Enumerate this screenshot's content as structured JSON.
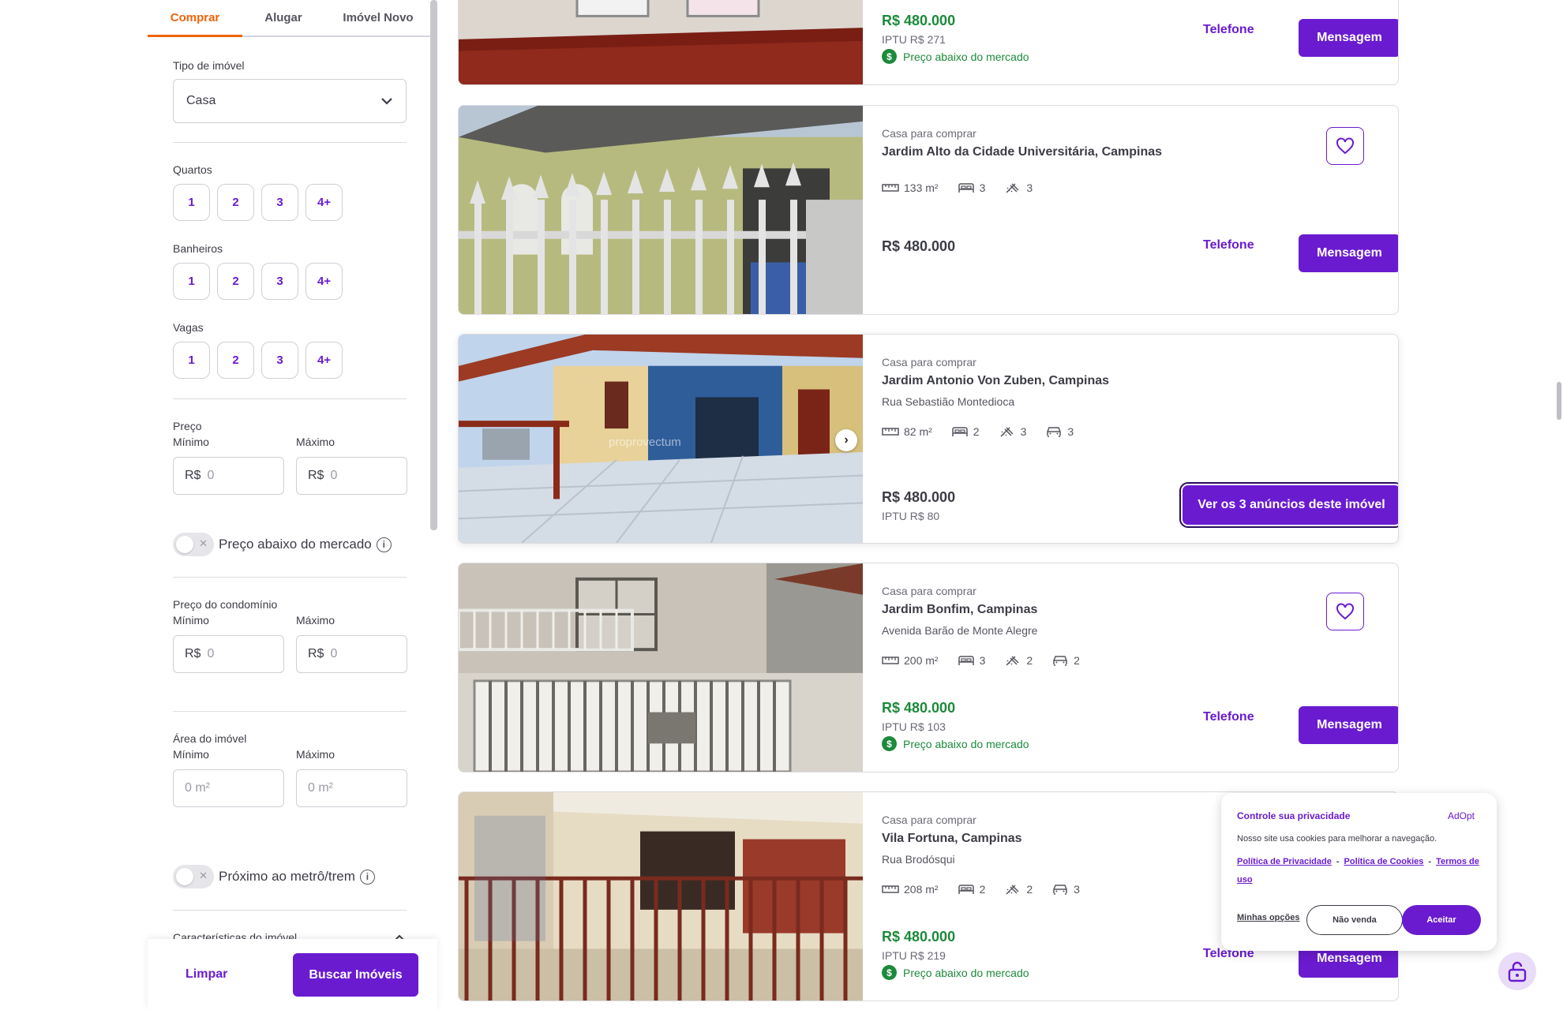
{
  "sidebar": {
    "tabs": [
      "Comprar",
      "Alugar",
      "Imóvel Novo"
    ],
    "property_type_label": "Tipo de imóvel",
    "property_type_value": "Casa",
    "bedrooms_label": "Quartos",
    "bathrooms_label": "Banheiros",
    "parking_label": "Vagas",
    "chip_options": [
      "1",
      "2",
      "3",
      "4+"
    ],
    "price_label": "Preço",
    "min_label": "Mínimo",
    "max_label": "Máximo",
    "currency_prefix": "R$",
    "money_placeholder": "0",
    "below_market_label": "Preço abaixo do mercado",
    "condo_price_label": "Preço do condomínio",
    "area_label": "Área do imóvel",
    "area_placeholder": "0 m²",
    "near_metro_label": "Próximo ao metrô/trem",
    "features_label": "Características do imóvel",
    "clear_label": "Limpar",
    "search_label": "Buscar Imóveis",
    "toggle_off_glyph": "✕",
    "info_glyph": "i"
  },
  "listings": [
    {
      "price": "R$ 480.000",
      "iptu": "IPTU R$ 271",
      "below_market": "Preço abaixo do mercado",
      "phone_label": "Telefone",
      "message_label": "Mensagem"
    },
    {
      "kind": "Casa para comprar",
      "place": "Jardim Alto da Cidade Universitária, Campinas",
      "area": "133 m²",
      "beds": "3",
      "baths": "3",
      "price": "R$ 480.000",
      "phone_label": "Telefone",
      "message_label": "Mensagem"
    },
    {
      "kind": "Casa para comprar",
      "place": "Jardim Antonio Von Zuben, Campinas",
      "street": "Rua Sebastião Montedioca",
      "area": "82 m²",
      "beds": "2",
      "baths": "3",
      "parking": "3",
      "price": "R$ 480.000",
      "iptu": "IPTU R$ 80",
      "ads_label": "Ver os 3 anúncios deste imóvel",
      "photo_watermark": "proprovectum"
    },
    {
      "kind": "Casa para comprar",
      "place": "Jardim Bonfim, Campinas",
      "street": "Avenida Barão de Monte Alegre",
      "area": "200 m²",
      "beds": "3",
      "baths": "2",
      "parking": "2",
      "price": "R$ 480.000",
      "iptu": "IPTU R$ 103",
      "below_market": "Preço abaixo do mercado",
      "phone_label": "Telefone",
      "message_label": "Mensagem"
    },
    {
      "kind": "Casa para comprar",
      "place": "Vila Fortuna, Campinas",
      "street": "Rua Brodósqui",
      "area": "208 m²",
      "beds": "2",
      "baths": "2",
      "parking": "3",
      "price": "R$ 480.000",
      "iptu": "IPTU R$ 219",
      "below_market": "Preço abaixo do mercado",
      "phone_label": "Telefone",
      "message_label": "Mensagem"
    }
  ],
  "cookie": {
    "title": "Controle sua privacidade",
    "brand": "AdOpt",
    "text": "Nosso site usa cookies para melhorar a navegação.",
    "privacy_link": "Política de Privacidade",
    "cookies_link": "Política de Cookies",
    "terms_link": "Termos de uso",
    "separator": "-",
    "options_label": "Minhas opções",
    "reject_label": "Não venda",
    "accept_label": "Aceitar"
  },
  "colors": {
    "brand": "#6a1bcf",
    "tab_active": "#f0640a",
    "green": "#1c8a3a"
  },
  "icons": [
    "chevron-down-icon",
    "info-icon",
    "ruler-icon",
    "bed-icon",
    "shower-icon",
    "car-icon",
    "heart-icon",
    "dollar-icon",
    "chevron-right-icon",
    "lock-icon"
  ]
}
